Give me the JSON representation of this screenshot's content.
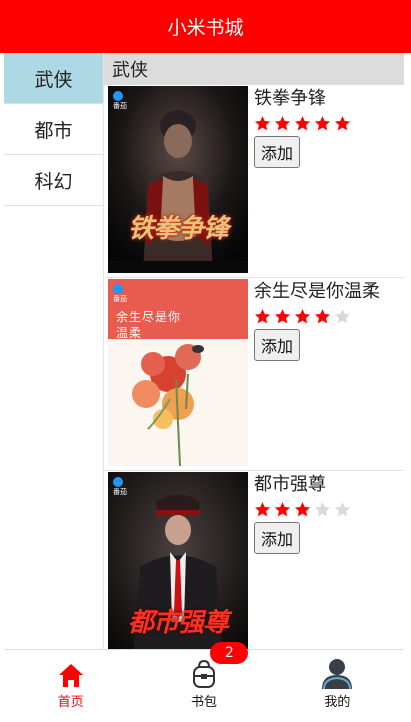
{
  "header": {
    "title": "小米书城"
  },
  "categories": [
    {
      "label": "武侠",
      "active": true
    },
    {
      "label": "都市",
      "active": false
    },
    {
      "label": "科幻",
      "active": false
    }
  ],
  "section": {
    "title": "武侠"
  },
  "books": [
    {
      "title": "铁拳争锋",
      "rating": 5,
      "max_rating": 5,
      "add_label": "添加",
      "cover_text": "铁拳争锋",
      "cover_badge": "番茄"
    },
    {
      "title": "余生尽是你温柔",
      "rating": 4,
      "max_rating": 5,
      "add_label": "添加",
      "cover_text": "余生尽是你温柔",
      "cover_badge": "番茄"
    },
    {
      "title": "都市强尊",
      "rating": 3,
      "max_rating": 5,
      "add_label": "添加",
      "cover_text": "都市强尊",
      "cover_badge": "番茄"
    }
  ],
  "tabbar": {
    "items": [
      {
        "label": "首页",
        "icon": "home-icon",
        "active": true
      },
      {
        "label": "书包",
        "icon": "bag-icon",
        "active": false,
        "badge": "2"
      },
      {
        "label": "我的",
        "icon": "user-icon",
        "active": false
      }
    ]
  },
  "colors": {
    "brand": "#ff0000",
    "active_category": "#add8e6",
    "star_on": "#ff0000",
    "star_off": "#d9d9d9"
  }
}
